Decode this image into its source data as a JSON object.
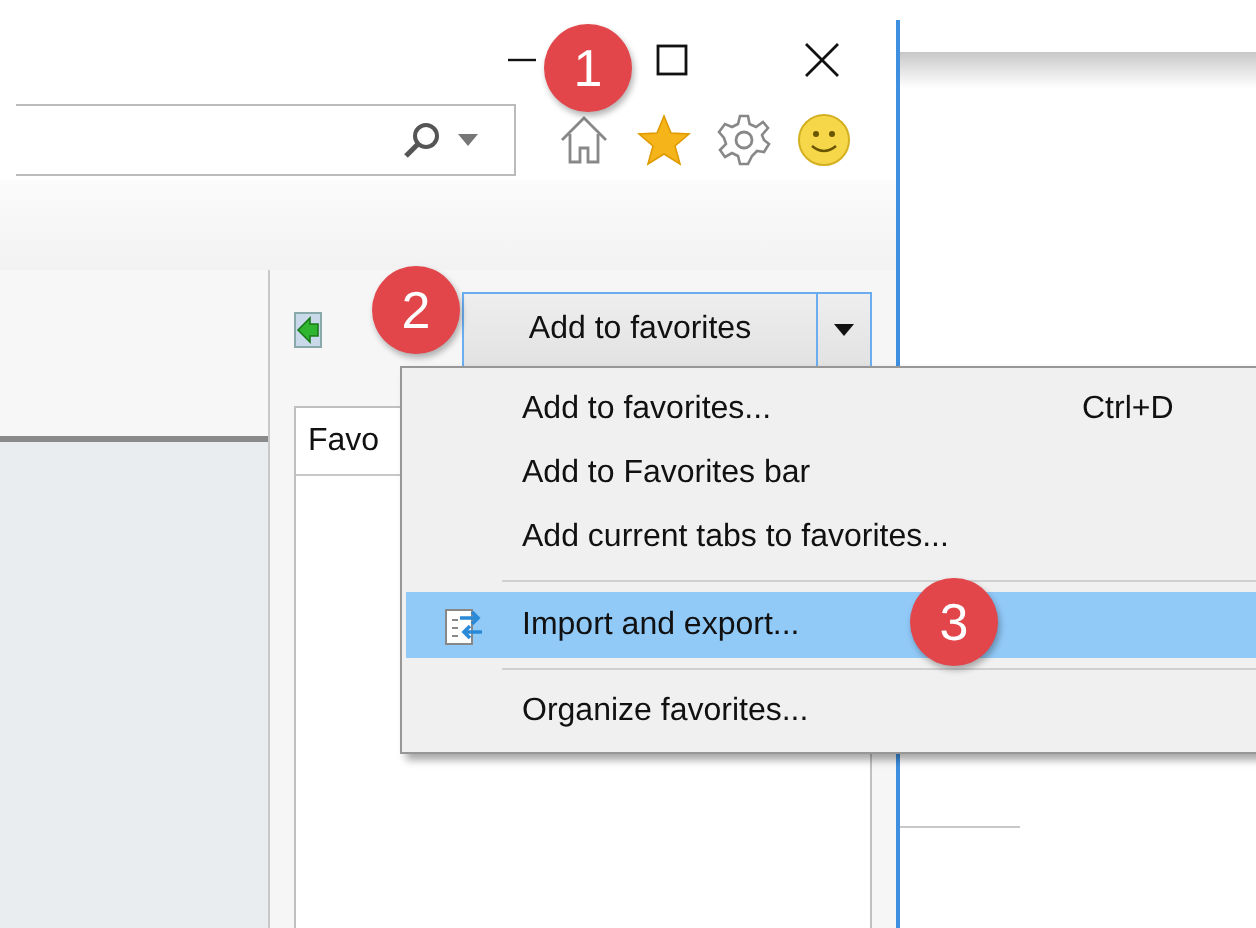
{
  "favorites_panel": {
    "add_button": {
      "label": "Add to favorites"
    },
    "list_header": "Favo"
  },
  "menu": [
    {
      "kind": "item",
      "label": "Add to favorites...",
      "shortcut": "Ctrl+D",
      "selected": false
    },
    {
      "kind": "item",
      "label": "Add to Favorites bar",
      "selected": false
    },
    {
      "kind": "item",
      "label": "Add current tabs to favorites...",
      "selected": false
    },
    {
      "kind": "separator"
    },
    {
      "kind": "item",
      "label": "Import and export...",
      "selected": true,
      "icon": true
    },
    {
      "kind": "separator"
    },
    {
      "kind": "item",
      "label": "Organize favorites...",
      "selected": false
    }
  ],
  "callouts": [
    "1",
    "2",
    "3"
  ]
}
